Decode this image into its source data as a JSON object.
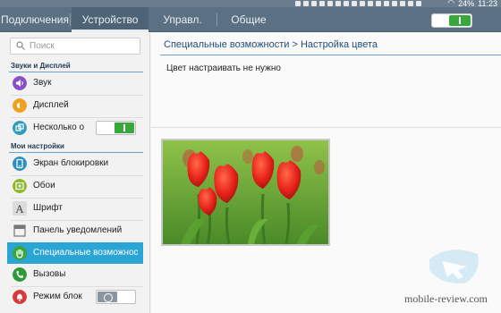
{
  "status_bar": {
    "battery": "24%",
    "time": "11:23",
    "notification_count": 16
  },
  "tabs": [
    {
      "label": "Подключения"
    },
    {
      "label": "Устройство"
    },
    {
      "label": "Управл."
    },
    {
      "label": "Общие"
    }
  ],
  "active_tab": "Устройство",
  "master_toggle": {
    "state": "on"
  },
  "search": {
    "placeholder": "Поиск"
  },
  "sidebar": {
    "sections": [
      {
        "header": "Звуки и Дисплей",
        "items": [
          {
            "label": "Звук",
            "icon": "speaker-icon",
            "color": "#8a4fc8"
          },
          {
            "label": "Дисплей",
            "icon": "brightness-icon",
            "color": "#f0a020"
          },
          {
            "label": "Несколько о",
            "icon": "multi-window-icon",
            "color": "#2f9bb8",
            "toggle": "on"
          }
        ]
      },
      {
        "header": "Мои настройки",
        "items": [
          {
            "label": "Экран блокировки",
            "icon": "lock-screen-icon",
            "color": "#2a8fc0"
          },
          {
            "label": "Обои",
            "icon": "wallpaper-icon",
            "color": "#8cb82a"
          },
          {
            "label": "Шрифт",
            "icon": "font-icon",
            "color": "#666666"
          },
          {
            "label": "Панель уведомлений",
            "icon": "notification-panel-icon",
            "color": "#777777"
          },
          {
            "label": "Специальные возможнос",
            "icon": "accessibility-hand-icon",
            "color": "#3aa63a",
            "selected": true
          },
          {
            "label": "Вызовы",
            "icon": "phone-icon",
            "color": "#2f9a3a"
          },
          {
            "label": "Режим блок",
            "icon": "blocking-mode-icon",
            "color": "#d63a3a",
            "toggle": "off"
          }
        ]
      }
    ]
  },
  "main": {
    "breadcrumb": "Специальные возможности > Настройка цвета",
    "message": "Цвет настраивать не нужно",
    "preview": {
      "subject": "red tulips on green background"
    }
  },
  "watermark": {
    "text": "mobile-review.com"
  },
  "colors": {
    "tabbar": "#5b7083",
    "accent_line": "#6fa3c9",
    "selected": "#2ba4d6",
    "toggle_on": "#39a83c"
  }
}
